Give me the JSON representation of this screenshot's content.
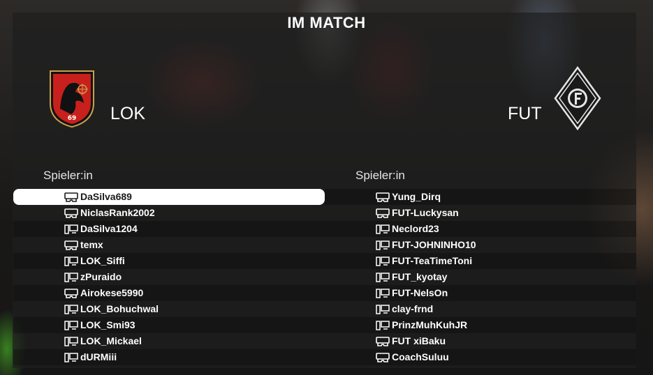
{
  "title": "IM MATCH",
  "home_team": {
    "name": "LOK",
    "crest_text": "69",
    "crest_icon": "lok-crest"
  },
  "away_team": {
    "name": "FUT",
    "crest_icon": "fut-crest"
  },
  "colors": {
    "selected_row": "#ffffff",
    "lok_red": "#c8201c"
  },
  "home_column": {
    "header": "Spieler:in",
    "players": [
      {
        "name": "DaSilva689",
        "platform": "console-icon",
        "selected": true
      },
      {
        "name": "NiclasRank2002",
        "platform": "console-icon"
      },
      {
        "name": "DaSilva1204",
        "platform": "pc-icon"
      },
      {
        "name": "temx",
        "platform": "console-icon"
      },
      {
        "name": "LOK_Siffi",
        "platform": "pc-icon"
      },
      {
        "name": "zPuraido",
        "platform": "pc-icon"
      },
      {
        "name": "Airokese5990",
        "platform": "console-icon"
      },
      {
        "name": "LOK_Bohuchwal",
        "platform": "pc-icon"
      },
      {
        "name": "LOK_Smi93",
        "platform": "pc-icon"
      },
      {
        "name": "LOK_Mickael",
        "platform": "pc-icon"
      },
      {
        "name": "dURMiii",
        "platform": "pc-icon"
      }
    ]
  },
  "away_column": {
    "header": "Spieler:in",
    "players": [
      {
        "name": "Yung_Dirq",
        "platform": "console-icon"
      },
      {
        "name": "FUT-Luckysan",
        "platform": "console-icon"
      },
      {
        "name": "Neclord23",
        "platform": "pc-icon"
      },
      {
        "name": "FUT-JOHNINHO10",
        "platform": "pc-icon"
      },
      {
        "name": "FUT-TeaTimeToni",
        "platform": "pc-icon"
      },
      {
        "name": "FUT_kyotay",
        "platform": "pc-icon"
      },
      {
        "name": "FUT-NelsOn",
        "platform": "pc-icon"
      },
      {
        "name": "clay-frnd",
        "platform": "pc-icon"
      },
      {
        "name": "PrinzMuhKuhJR",
        "platform": "pc-icon"
      },
      {
        "name": "FUT xiBaku",
        "platform": "console-icon"
      },
      {
        "name": "CoachSuluu",
        "platform": "console-icon"
      }
    ]
  }
}
